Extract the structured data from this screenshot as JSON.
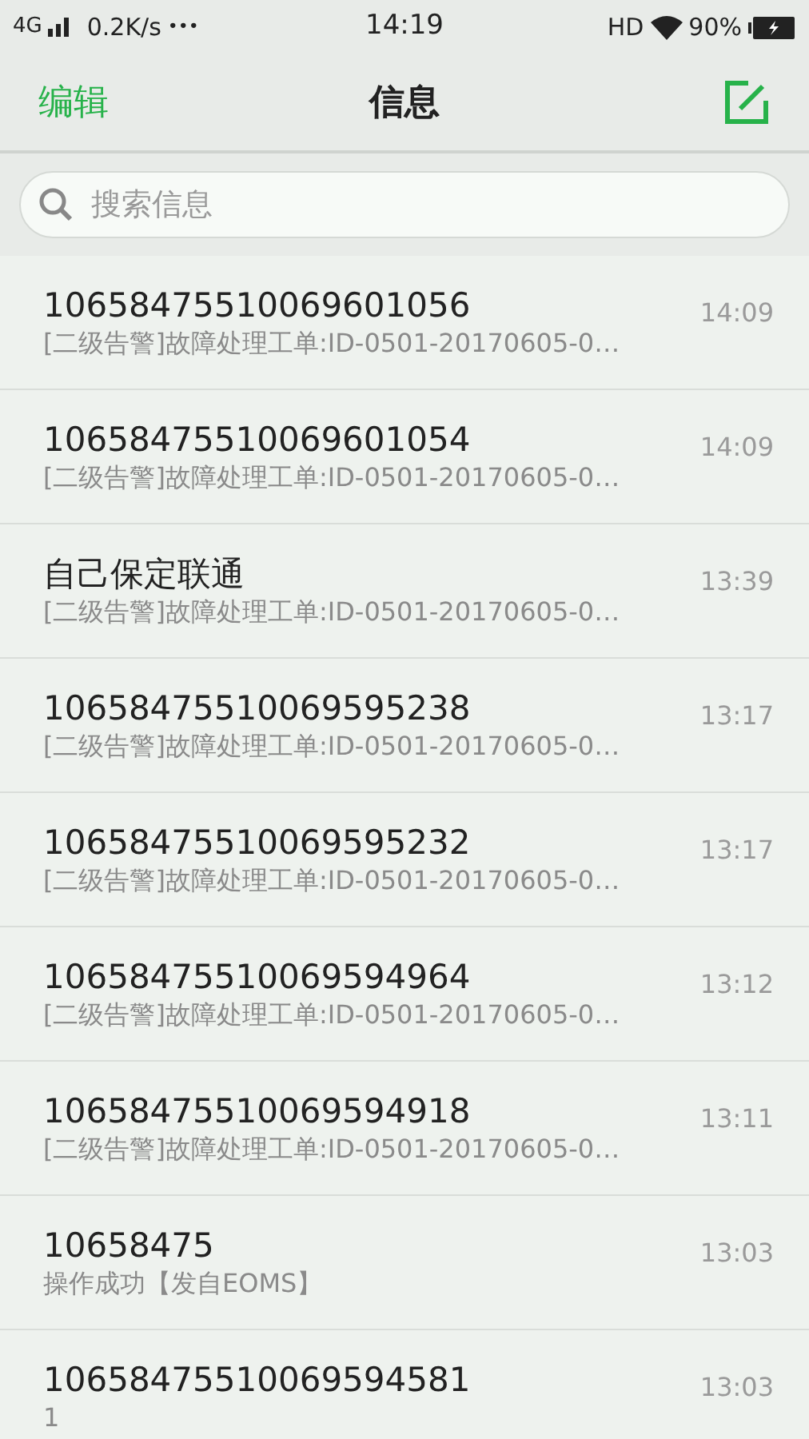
{
  "status_bar": {
    "network": "4G",
    "speed": "0.2K/s",
    "more": "•••",
    "time": "14:19",
    "hd": "HD",
    "battery": "90%"
  },
  "header": {
    "edit": "编辑",
    "title": "信息"
  },
  "search": {
    "placeholder": "搜索信息"
  },
  "messages": [
    {
      "sender": "10658475510069601056",
      "preview": "[二级告警]故障处理工单:ID-0501-20170605-0…",
      "time": "14:09"
    },
    {
      "sender": "10658475510069601054",
      "preview": "[二级告警]故障处理工单:ID-0501-20170605-0…",
      "time": "14:09"
    },
    {
      "sender": "自己保定联通",
      "preview": "[二级告警]故障处理工单:ID-0501-20170605-0…",
      "time": "13:39"
    },
    {
      "sender": "10658475510069595238",
      "preview": "[二级告警]故障处理工单:ID-0501-20170605-0…",
      "time": "13:17"
    },
    {
      "sender": "10658475510069595232",
      "preview": "[二级告警]故障处理工单:ID-0501-20170605-0…",
      "time": "13:17"
    },
    {
      "sender": "10658475510069594964",
      "preview": "[二级告警]故障处理工单:ID-0501-20170605-0…",
      "time": "13:12"
    },
    {
      "sender": "10658475510069594918",
      "preview": "[二级告警]故障处理工单:ID-0501-20170605-0…",
      "time": "13:11"
    },
    {
      "sender": "10658475",
      "preview": "操作成功【发自EOMS】",
      "time": "13:03"
    },
    {
      "sender": "10658475510069594581",
      "preview": "1",
      "time": "13:03"
    }
  ]
}
